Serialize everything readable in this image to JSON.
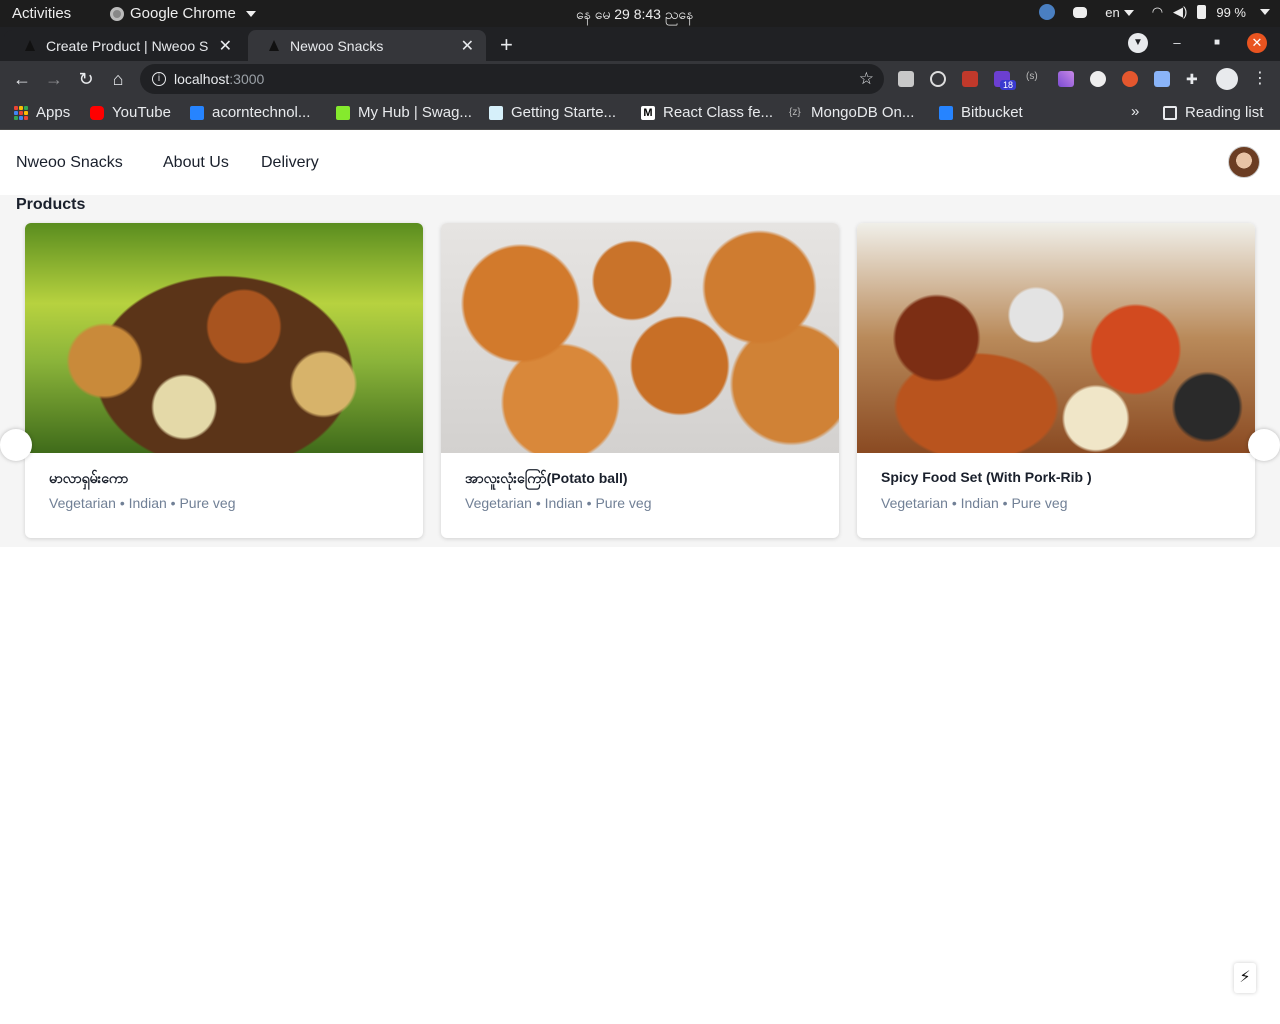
{
  "system_bar": {
    "activities": "Activities",
    "app_name": "Google Chrome",
    "clock": "နေ မေ 29   8:43 ညနေ",
    "lang": "en",
    "battery": "99 %"
  },
  "tabs": [
    {
      "title": "Create Product | Nweoo S",
      "active": false
    },
    {
      "title": "Newoo Snacks",
      "active": true
    }
  ],
  "address_bar": {
    "host": "localhost",
    "port": ":3000"
  },
  "extensions": {
    "badge": "18"
  },
  "bookmarks": [
    {
      "label": "Apps",
      "icon": "apps-grid-icon"
    },
    {
      "label": "YouTube",
      "icon": "youtube-icon"
    },
    {
      "label": "acorntechnol...",
      "icon": "bitbucket-icon"
    },
    {
      "label": "My Hub | Swag...",
      "icon": "swagger-icon"
    },
    {
      "label": "Getting Starte...",
      "icon": "doc-icon"
    },
    {
      "label": "React Class fe...",
      "icon": "medium-icon"
    },
    {
      "label": "MongoDB On...",
      "icon": "braces-icon"
    },
    {
      "label": "Bitbucket",
      "icon": "bitbucket-icon"
    }
  ],
  "reading_list": "Reading list",
  "site": {
    "brand": "Nweoo Snacks",
    "nav": [
      "About Us",
      "Delivery"
    ]
  },
  "products": {
    "heading": "Products",
    "items": [
      {
        "name": "မာလာရှမ်းကော",
        "tags": "Vegetarian • Indian • Pure veg"
      },
      {
        "name": "အာလူးလုံးကြော်(Potato ball)",
        "tags": "Vegetarian • Indian • Pure veg"
      },
      {
        "name": "Spicy Food Set (With Pork-Rib )",
        "tags": "Vegetarian • Indian • Pure veg"
      }
    ]
  },
  "colors": {
    "chrome_dark": "#202124",
    "chrome_toolbar": "#35363a",
    "close_red": "#e95420",
    "text_dark": "#1a202c",
    "text_muted": "#718096",
    "section_bg": "#f5f5f5"
  }
}
